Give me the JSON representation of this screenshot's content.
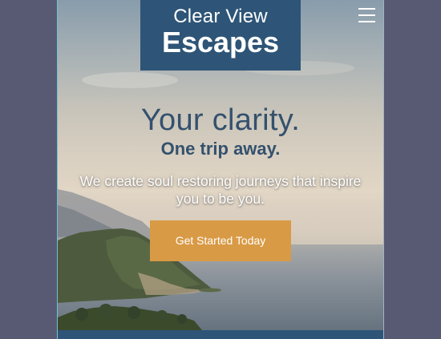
{
  "brand": {
    "name_line1": "Clear View",
    "name_line2": "Escapes",
    "color": "#2e5577"
  },
  "nav": {
    "menu_icon": "hamburger-menu-icon"
  },
  "hero": {
    "headline": "Your clarity.",
    "subheadline": "One trip away.",
    "tagline": "We create soul restoring journeys that inspire you to be you.",
    "background": "coastal cliffs and sea at sunset"
  },
  "cta": {
    "label": "Get Started Today",
    "color": "#d99a45"
  },
  "colors": {
    "page_background": "#585a74",
    "text_headline": "#34516e"
  }
}
